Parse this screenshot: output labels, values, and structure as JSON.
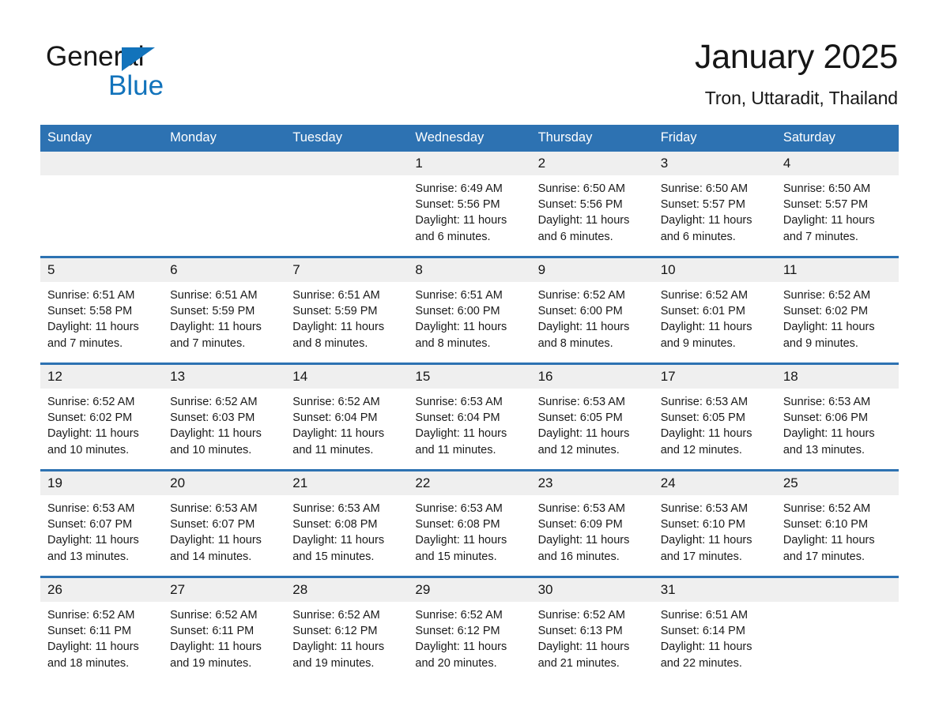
{
  "brand": {
    "name_part1": "General",
    "name_part2": "Blue",
    "triangle_color": "#1273bb"
  },
  "header": {
    "title": "January 2025",
    "subtitle": "Tron, Uttaradit, Thailand"
  },
  "theme": {
    "header_blue": "#2d72b2",
    "daynum_gray": "#efefef",
    "text_black": "#161616"
  },
  "calendar": {
    "weekday_headers": [
      "Sunday",
      "Monday",
      "Tuesday",
      "Wednesday",
      "Thursday",
      "Friday",
      "Saturday"
    ],
    "weeks": [
      [
        {
          "empty": true,
          "day": ""
        },
        {
          "empty": true,
          "day": ""
        },
        {
          "empty": true,
          "day": ""
        },
        {
          "day": "1",
          "sunrise": "Sunrise: 6:49 AM",
          "sunset": "Sunset: 5:56 PM",
          "daylight": "Daylight: 11 hours and 6 minutes."
        },
        {
          "day": "2",
          "sunrise": "Sunrise: 6:50 AM",
          "sunset": "Sunset: 5:56 PM",
          "daylight": "Daylight: 11 hours and 6 minutes."
        },
        {
          "day": "3",
          "sunrise": "Sunrise: 6:50 AM",
          "sunset": "Sunset: 5:57 PM",
          "daylight": "Daylight: 11 hours and 6 minutes."
        },
        {
          "day": "4",
          "sunrise": "Sunrise: 6:50 AM",
          "sunset": "Sunset: 5:57 PM",
          "daylight": "Daylight: 11 hours and 7 minutes."
        }
      ],
      [
        {
          "day": "5",
          "sunrise": "Sunrise: 6:51 AM",
          "sunset": "Sunset: 5:58 PM",
          "daylight": "Daylight: 11 hours and 7 minutes."
        },
        {
          "day": "6",
          "sunrise": "Sunrise: 6:51 AM",
          "sunset": "Sunset: 5:59 PM",
          "daylight": "Daylight: 11 hours and 7 minutes."
        },
        {
          "day": "7",
          "sunrise": "Sunrise: 6:51 AM",
          "sunset": "Sunset: 5:59 PM",
          "daylight": "Daylight: 11 hours and 8 minutes."
        },
        {
          "day": "8",
          "sunrise": "Sunrise: 6:51 AM",
          "sunset": "Sunset: 6:00 PM",
          "daylight": "Daylight: 11 hours and 8 minutes."
        },
        {
          "day": "9",
          "sunrise": "Sunrise: 6:52 AM",
          "sunset": "Sunset: 6:00 PM",
          "daylight": "Daylight: 11 hours and 8 minutes."
        },
        {
          "day": "10",
          "sunrise": "Sunrise: 6:52 AM",
          "sunset": "Sunset: 6:01 PM",
          "daylight": "Daylight: 11 hours and 9 minutes."
        },
        {
          "day": "11",
          "sunrise": "Sunrise: 6:52 AM",
          "sunset": "Sunset: 6:02 PM",
          "daylight": "Daylight: 11 hours and 9 minutes."
        }
      ],
      [
        {
          "day": "12",
          "sunrise": "Sunrise: 6:52 AM",
          "sunset": "Sunset: 6:02 PM",
          "daylight": "Daylight: 11 hours and 10 minutes."
        },
        {
          "day": "13",
          "sunrise": "Sunrise: 6:52 AM",
          "sunset": "Sunset: 6:03 PM",
          "daylight": "Daylight: 11 hours and 10 minutes."
        },
        {
          "day": "14",
          "sunrise": "Sunrise: 6:52 AM",
          "sunset": "Sunset: 6:04 PM",
          "daylight": "Daylight: 11 hours and 11 minutes."
        },
        {
          "day": "15",
          "sunrise": "Sunrise: 6:53 AM",
          "sunset": "Sunset: 6:04 PM",
          "daylight": "Daylight: 11 hours and 11 minutes."
        },
        {
          "day": "16",
          "sunrise": "Sunrise: 6:53 AM",
          "sunset": "Sunset: 6:05 PM",
          "daylight": "Daylight: 11 hours and 12 minutes."
        },
        {
          "day": "17",
          "sunrise": "Sunrise: 6:53 AM",
          "sunset": "Sunset: 6:05 PM",
          "daylight": "Daylight: 11 hours and 12 minutes."
        },
        {
          "day": "18",
          "sunrise": "Sunrise: 6:53 AM",
          "sunset": "Sunset: 6:06 PM",
          "daylight": "Daylight: 11 hours and 13 minutes."
        }
      ],
      [
        {
          "day": "19",
          "sunrise": "Sunrise: 6:53 AM",
          "sunset": "Sunset: 6:07 PM",
          "daylight": "Daylight: 11 hours and 13 minutes."
        },
        {
          "day": "20",
          "sunrise": "Sunrise: 6:53 AM",
          "sunset": "Sunset: 6:07 PM",
          "daylight": "Daylight: 11 hours and 14 minutes."
        },
        {
          "day": "21",
          "sunrise": "Sunrise: 6:53 AM",
          "sunset": "Sunset: 6:08 PM",
          "daylight": "Daylight: 11 hours and 15 minutes."
        },
        {
          "day": "22",
          "sunrise": "Sunrise: 6:53 AM",
          "sunset": "Sunset: 6:08 PM",
          "daylight": "Daylight: 11 hours and 15 minutes."
        },
        {
          "day": "23",
          "sunrise": "Sunrise: 6:53 AM",
          "sunset": "Sunset: 6:09 PM",
          "daylight": "Daylight: 11 hours and 16 minutes."
        },
        {
          "day": "24",
          "sunrise": "Sunrise: 6:53 AM",
          "sunset": "Sunset: 6:10 PM",
          "daylight": "Daylight: 11 hours and 17 minutes."
        },
        {
          "day": "25",
          "sunrise": "Sunrise: 6:52 AM",
          "sunset": "Sunset: 6:10 PM",
          "daylight": "Daylight: 11 hours and 17 minutes."
        }
      ],
      [
        {
          "day": "26",
          "sunrise": "Sunrise: 6:52 AM",
          "sunset": "Sunset: 6:11 PM",
          "daylight": "Daylight: 11 hours and 18 minutes."
        },
        {
          "day": "27",
          "sunrise": "Sunrise: 6:52 AM",
          "sunset": "Sunset: 6:11 PM",
          "daylight": "Daylight: 11 hours and 19 minutes."
        },
        {
          "day": "28",
          "sunrise": "Sunrise: 6:52 AM",
          "sunset": "Sunset: 6:12 PM",
          "daylight": "Daylight: 11 hours and 19 minutes."
        },
        {
          "day": "29",
          "sunrise": "Sunrise: 6:52 AM",
          "sunset": "Sunset: 6:12 PM",
          "daylight": "Daylight: 11 hours and 20 minutes."
        },
        {
          "day": "30",
          "sunrise": "Sunrise: 6:52 AM",
          "sunset": "Sunset: 6:13 PM",
          "daylight": "Daylight: 11 hours and 21 minutes."
        },
        {
          "day": "31",
          "sunrise": "Sunrise: 6:51 AM",
          "sunset": "Sunset: 6:14 PM",
          "daylight": "Daylight: 11 hours and 22 minutes."
        },
        {
          "empty": true,
          "day": ""
        }
      ]
    ]
  }
}
